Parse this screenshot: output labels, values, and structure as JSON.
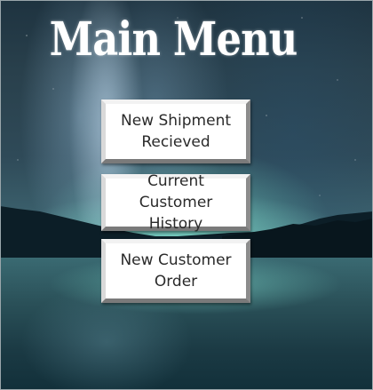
{
  "menu": {
    "title": "Main Menu",
    "buttons": [
      {
        "line1": "New Shipment",
        "line2": "Recieved"
      },
      {
        "line1": "Current Customer",
        "line2": "History"
      },
      {
        "line1": "New Customer",
        "line2": "Order"
      }
    ]
  },
  "background": {
    "scene": "aurora-over-lake",
    "colors": {
      "sky": "#29404c",
      "aurora": "#78e1cd",
      "mountains": "#0c1e27",
      "lake": "#2a5058"
    }
  },
  "button_style": {
    "face": "#ffffff",
    "text": "#2a2a2a"
  }
}
